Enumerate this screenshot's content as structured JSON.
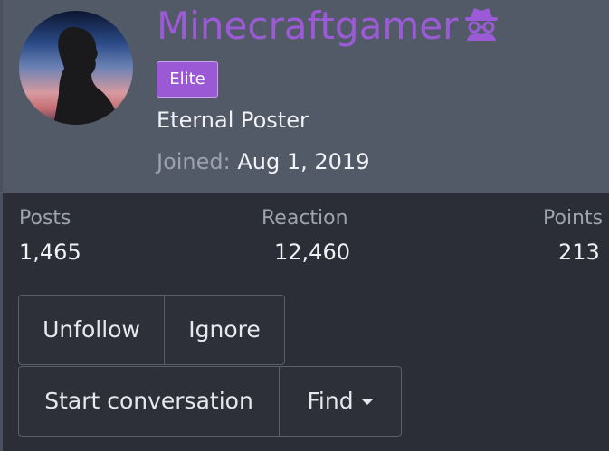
{
  "profile": {
    "username": "Minecraftgamer",
    "username_icon": "incognito-spy-icon",
    "badge": "Elite",
    "title": "Eternal Poster",
    "joined_label": "Joined:",
    "joined_date": "Aug 1, 2019",
    "username_color": "#9b5ad6",
    "badge_color": "#9b59d6"
  },
  "stats": {
    "posts_label": "Posts",
    "posts_value": "1,465",
    "reaction_label": "Reaction",
    "reaction_value": "12,460",
    "points_label": "Points",
    "points_value": "213"
  },
  "actions": {
    "unfollow": "Unfollow",
    "ignore": "Ignore",
    "start_conversation": "Start conversation",
    "find": "Find"
  }
}
